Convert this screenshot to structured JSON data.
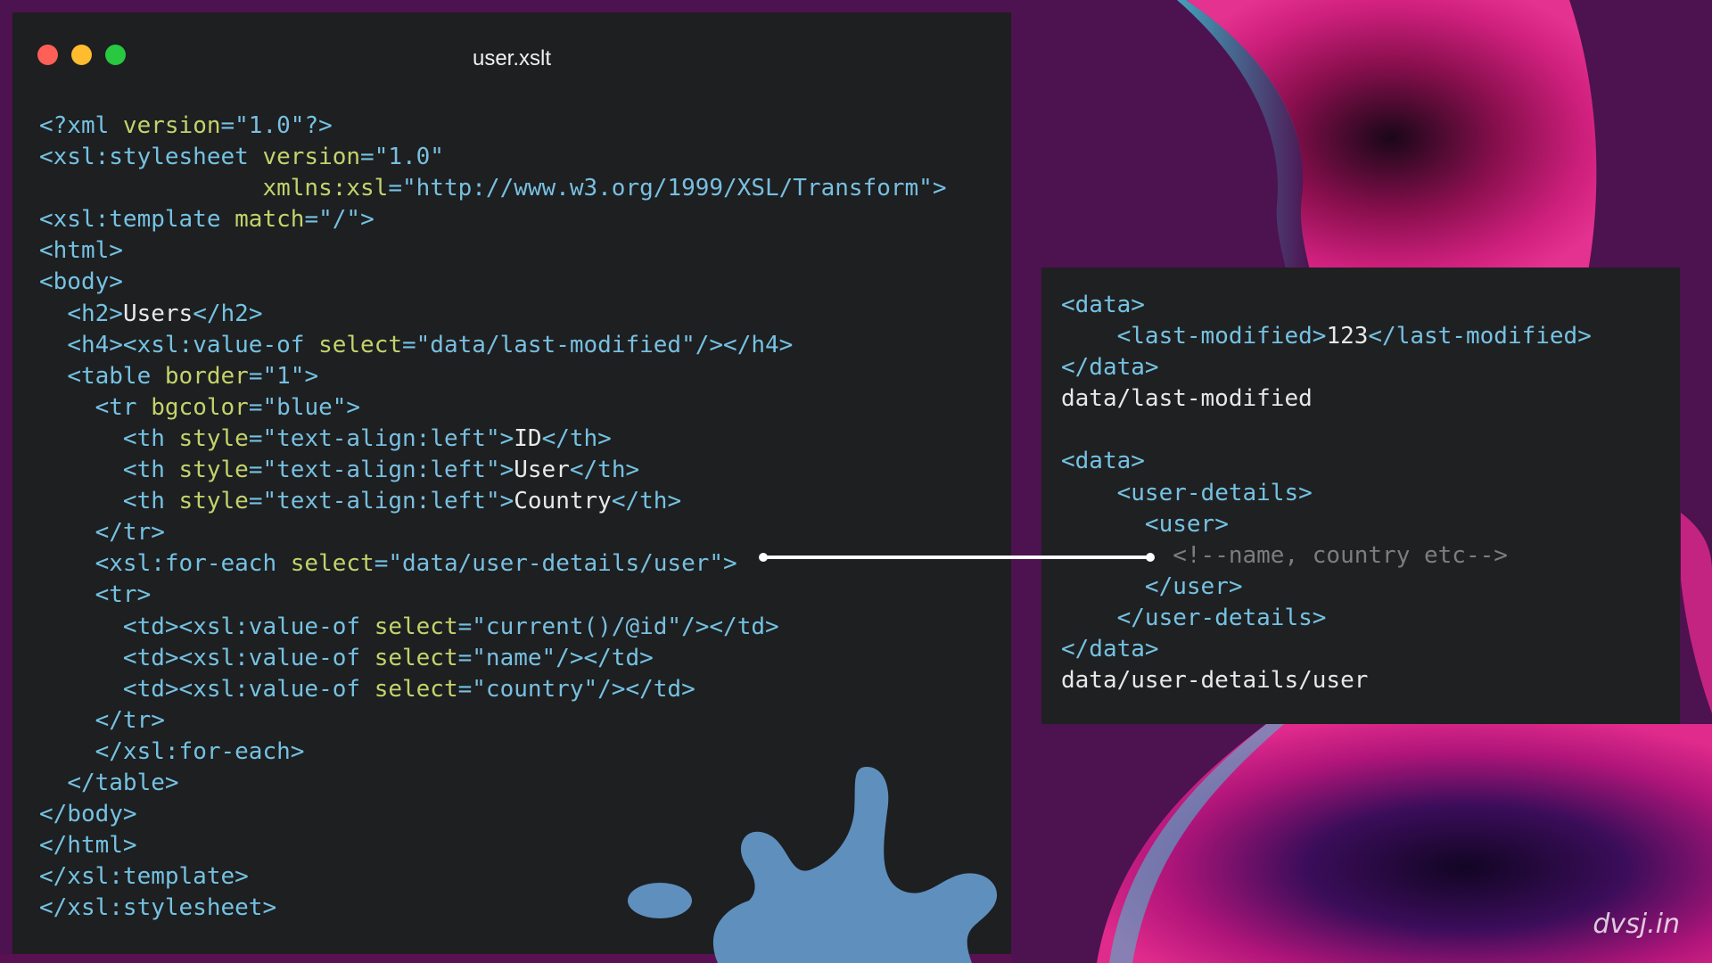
{
  "window": {
    "title": "user.xslt"
  },
  "colors": {
    "tag": "#75c2e2",
    "attr": "#c4d26a",
    "value": "#79bfe0",
    "text": "#e8e8e8",
    "comment": "#7d7d7d",
    "splash": "#5f8fbd"
  },
  "code": [
    [
      [
        "t",
        "<?xml "
      ],
      [
        "a",
        "version"
      ],
      [
        "t",
        "="
      ],
      [
        "v",
        "\"1.0\""
      ],
      [
        "t",
        "?>"
      ]
    ],
    [
      [
        "t",
        "<xsl:stylesheet "
      ],
      [
        "a",
        "version"
      ],
      [
        "t",
        "="
      ],
      [
        "v",
        "\"1.0\""
      ]
    ],
    [
      [
        "x",
        "                "
      ],
      [
        "a",
        "xmlns:xsl"
      ],
      [
        "t",
        "="
      ],
      [
        "v",
        "\"http://www.w3.org/1999/XSL/Transform\""
      ],
      [
        "t",
        ">"
      ]
    ],
    [
      [
        "t",
        "<xsl:template "
      ],
      [
        "a",
        "match"
      ],
      [
        "t",
        "="
      ],
      [
        "v",
        "\"/\""
      ],
      [
        "t",
        ">"
      ]
    ],
    [
      [
        "t",
        "<html>"
      ]
    ],
    [
      [
        "t",
        "<body>"
      ]
    ],
    [
      [
        "x",
        "  "
      ],
      [
        "t",
        "<h2>"
      ],
      [
        "x",
        "Users"
      ],
      [
        "t",
        "</h2>"
      ]
    ],
    [
      [
        "x",
        "  "
      ],
      [
        "t",
        "<h4><xsl:value-of "
      ],
      [
        "a",
        "select"
      ],
      [
        "t",
        "="
      ],
      [
        "v",
        "\"data/last-modified\""
      ],
      [
        "t",
        "/></h4>"
      ]
    ],
    [
      [
        "x",
        "  "
      ],
      [
        "t",
        "<table "
      ],
      [
        "a",
        "border"
      ],
      [
        "t",
        "="
      ],
      [
        "v",
        "\"1\""
      ],
      [
        "t",
        ">"
      ]
    ],
    [
      [
        "x",
        "    "
      ],
      [
        "t",
        "<tr "
      ],
      [
        "a",
        "bgcolor"
      ],
      [
        "t",
        "="
      ],
      [
        "v",
        "\"blue\""
      ],
      [
        "t",
        ">"
      ]
    ],
    [
      [
        "x",
        "      "
      ],
      [
        "t",
        "<th "
      ],
      [
        "a",
        "style"
      ],
      [
        "t",
        "="
      ],
      [
        "v",
        "\"text-align:left\""
      ],
      [
        "t",
        ">"
      ],
      [
        "x",
        "ID"
      ],
      [
        "t",
        "</th>"
      ]
    ],
    [
      [
        "x",
        "      "
      ],
      [
        "t",
        "<th "
      ],
      [
        "a",
        "style"
      ],
      [
        "t",
        "="
      ],
      [
        "v",
        "\"text-align:left\""
      ],
      [
        "t",
        ">"
      ],
      [
        "x",
        "User"
      ],
      [
        "t",
        "</th>"
      ]
    ],
    [
      [
        "x",
        "      "
      ],
      [
        "t",
        "<th "
      ],
      [
        "a",
        "style"
      ],
      [
        "t",
        "="
      ],
      [
        "v",
        "\"text-align:left\""
      ],
      [
        "t",
        ">"
      ],
      [
        "x",
        "Country"
      ],
      [
        "t",
        "</th>"
      ]
    ],
    [
      [
        "x",
        "    "
      ],
      [
        "t",
        "</tr>"
      ]
    ],
    [
      [
        "x",
        "    "
      ],
      [
        "t",
        "<xsl:for-each "
      ],
      [
        "a",
        "select"
      ],
      [
        "t",
        "="
      ],
      [
        "v",
        "\"data/user-details/user\""
      ],
      [
        "t",
        ">"
      ]
    ],
    [
      [
        "x",
        "    "
      ],
      [
        "t",
        "<tr>"
      ]
    ],
    [
      [
        "x",
        "      "
      ],
      [
        "t",
        "<td><xsl:value-of "
      ],
      [
        "a",
        "select"
      ],
      [
        "t",
        "="
      ],
      [
        "v",
        "\"current()/@id\""
      ],
      [
        "t",
        "/></td>"
      ]
    ],
    [
      [
        "x",
        "      "
      ],
      [
        "t",
        "<td><xsl:value-of "
      ],
      [
        "a",
        "select"
      ],
      [
        "t",
        "="
      ],
      [
        "v",
        "\"name\""
      ],
      [
        "t",
        "/></td>"
      ]
    ],
    [
      [
        "x",
        "      "
      ],
      [
        "t",
        "<td><xsl:value-of "
      ],
      [
        "a",
        "select"
      ],
      [
        "t",
        "="
      ],
      [
        "v",
        "\"country\""
      ],
      [
        "t",
        "/></td>"
      ]
    ],
    [
      [
        "x",
        "    "
      ],
      [
        "t",
        "</tr>"
      ]
    ],
    [
      [
        "x",
        "    "
      ],
      [
        "t",
        "</xsl:for-each>"
      ]
    ],
    [
      [
        "x",
        "  "
      ],
      [
        "t",
        "</table>"
      ]
    ],
    [
      [
        "t",
        "</body>"
      ]
    ],
    [
      [
        "t",
        "</html>"
      ]
    ],
    [
      [
        "t",
        "</xsl:template>"
      ]
    ],
    [
      [
        "t",
        "</xsl:stylesheet>"
      ]
    ]
  ],
  "panel_code": [
    [
      [
        "t",
        "<data>"
      ]
    ],
    [
      [
        "x",
        "    "
      ],
      [
        "t",
        "<last-modified>"
      ],
      [
        "x",
        "123"
      ],
      [
        "t",
        "</last-modified>"
      ]
    ],
    [
      [
        "t",
        "</data>"
      ]
    ],
    [
      [
        "x",
        "data/last-modified"
      ]
    ],
    [
      [
        "x",
        ""
      ]
    ],
    [
      [
        "t",
        "<data>"
      ]
    ],
    [
      [
        "x",
        "    "
      ],
      [
        "t",
        "<user-details>"
      ]
    ],
    [
      [
        "x",
        "      "
      ],
      [
        "t",
        "<user>"
      ]
    ],
    [
      [
        "x",
        "        "
      ],
      [
        "c",
        "<!--name, country etc-->"
      ]
    ],
    [
      [
        "x",
        "      "
      ],
      [
        "t",
        "</user>"
      ]
    ],
    [
      [
        "x",
        "    "
      ],
      [
        "t",
        "</user-details>"
      ]
    ],
    [
      [
        "t",
        "</data>"
      ]
    ],
    [
      [
        "x",
        "data/user-details/user"
      ]
    ]
  ],
  "watermark": "dvsj.in"
}
